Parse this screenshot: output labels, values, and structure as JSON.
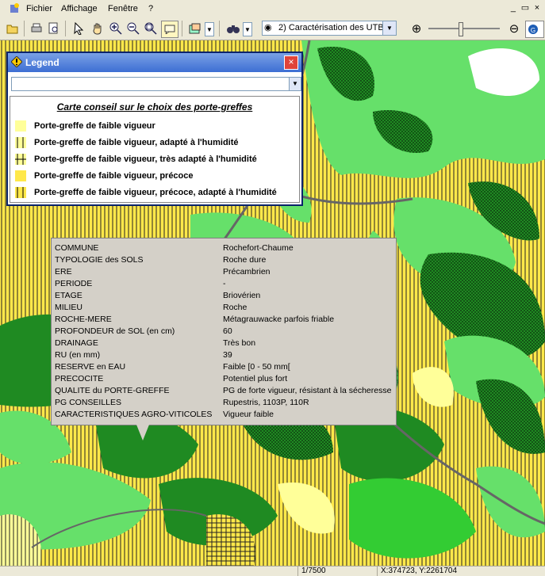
{
  "menubar": {
    "items": [
      "Fichier",
      "Affichage",
      "Fenêtre",
      "?"
    ],
    "window_controls": [
      "_",
      "▭",
      "×"
    ]
  },
  "toolbar": {
    "icons": [
      "open-icon",
      "print-icon",
      "print-preview-icon",
      "select-arrow-icon",
      "pan-hand-icon",
      "zoom-in-icon",
      "zoom-out-icon",
      "zoom-extent-icon",
      "info-icon",
      "layer-icon",
      "binoculars-icon"
    ],
    "layer_select": "2) Caractérisation des UTB",
    "zoom_in": "⊕",
    "zoom_out": "⊖"
  },
  "legend": {
    "title": "Legend",
    "close": "×",
    "heading": "Carte conseil sur le choix des porte-greffes",
    "items": [
      {
        "label": "Porte-greffe de faible vigueur",
        "pattern": "solid-light-yellow",
        "color": "#ffff99"
      },
      {
        "label": "Porte-greffe de faible vigueur, adapté à l'humidité",
        "pattern": "vertical-lines",
        "color": "#ffff99"
      },
      {
        "label": "Porte-greffe de faible vigueur, très adapté à l'humidité",
        "pattern": "cross-hatch",
        "color": "#ffff99"
      },
      {
        "label": "Porte-greffe de faible vigueur, précoce",
        "pattern": "solid-yellow",
        "color": "#ffe84a"
      },
      {
        "label": "Porte-greffe de faible vigueur, précoce, adapté à l'humidité",
        "pattern": "vertical-lines-yellow",
        "color": "#ffe84a"
      }
    ]
  },
  "info": {
    "rows": [
      {
        "k": "COMMUNE",
        "v": "Rochefort-Chaume"
      },
      {
        "k": "TYPOLOGIE des SOLS",
        "v": "Roche dure"
      },
      {
        "k": "ERE",
        "v": "Précambrien"
      },
      {
        "k": "PERIODE",
        "v": "-"
      },
      {
        "k": "ETAGE",
        "v": "Briovérien"
      },
      {
        "k": "MILIEU",
        "v": "Roche"
      },
      {
        "k": "ROCHE-MERE",
        "v": "Métagrauwacke parfois friable"
      },
      {
        "k": "PROFONDEUR de SOL (en cm)",
        "v": "60"
      },
      {
        "k": "DRAINAGE",
        "v": "Très bon"
      },
      {
        "k": "RU (en mm)",
        "v": "39"
      },
      {
        "k": "RESERVE en EAU",
        "v": "Faible [0 - 50 mm["
      },
      {
        "k": "PRECOCITE",
        "v": "Potentiel plus fort"
      },
      {
        "k": "QUALITE du PORTE-GREFFE",
        "v": "PG de forte vigueur, résistant à la sécheresse"
      },
      {
        "k": "PG CONSEILLES",
        "v": "Rupestris, 1103P, 110R"
      },
      {
        "k": "CARACTERISTIQUES AGRO-VITICOLES",
        "v": "Vigueur faible"
      }
    ]
  },
  "status": {
    "scale": "1/7500",
    "coords": "X:374723, Y:2261704"
  },
  "colors": {
    "light_yellow": "#ffff99",
    "yellow": "#ffe84a",
    "light_green": "#66e06a",
    "green": "#33cc33",
    "dark_green": "#1f8a22",
    "white": "#ffffff",
    "road": "#666666"
  }
}
